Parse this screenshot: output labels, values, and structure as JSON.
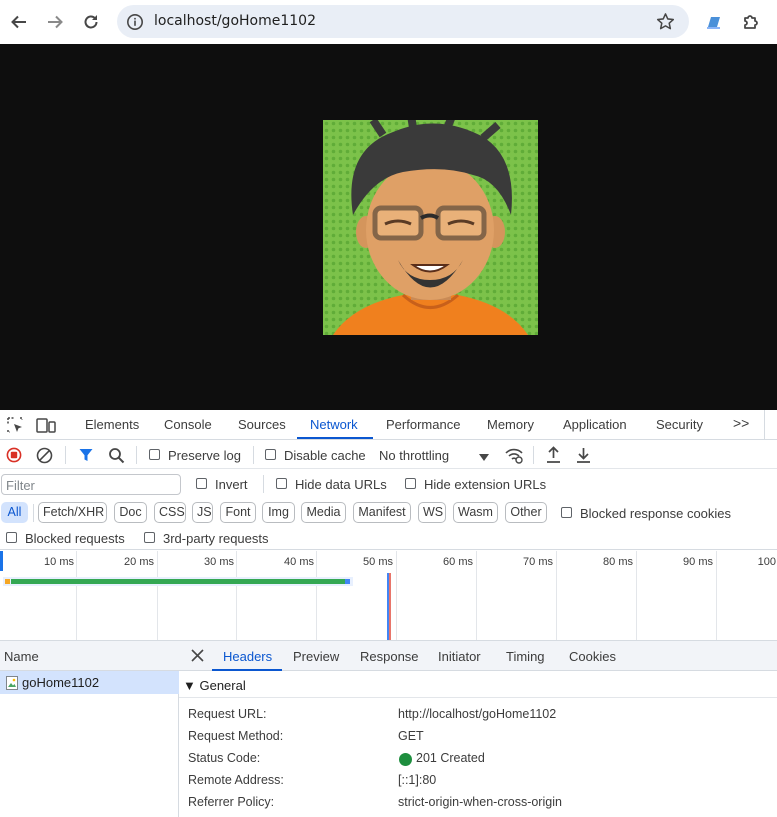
{
  "browser": {
    "url": "localhost/goHome1102",
    "icons": [
      "back-arrow-icon",
      "forward-arrow-icon",
      "reload-icon",
      "info-icon",
      "star-icon",
      "extension-icon",
      "puzzle-icon"
    ]
  },
  "devtools": {
    "tabs": [
      "Elements",
      "Console",
      "Sources",
      "Network",
      "Performance",
      "Memory",
      "Application",
      "Security"
    ],
    "active_tab": "Network",
    "more": ">>",
    "toolbar": {
      "preserve_log": "Preserve log",
      "disable_cache": "Disable cache",
      "throttling": "No throttling"
    },
    "filter": {
      "placeholder": "Filter",
      "invert": "Invert",
      "hide_data_urls": "Hide data URLs",
      "hide_extension_urls": "Hide extension URLs"
    },
    "types": [
      "All",
      "Fetch/XHR",
      "Doc",
      "CSS",
      "JS",
      "Font",
      "Img",
      "Media",
      "Manifest",
      "WS",
      "Wasm",
      "Other"
    ],
    "blocked_response_cookies": "Blocked response cookies",
    "blocked_requests": "Blocked requests",
    "third_party_requests": "3rd-party requests",
    "timeline_ticks": [
      "10 ms",
      "20 ms",
      "30 ms",
      "40 ms",
      "50 ms",
      "60 ms",
      "70 ms",
      "80 ms",
      "90 ms",
      "100"
    ],
    "list": {
      "header": "Name",
      "rows": [
        "goHome1102"
      ]
    },
    "details": {
      "tabs": [
        "Headers",
        "Preview",
        "Response",
        "Initiator",
        "Timing",
        "Cookies"
      ],
      "active_tab": "Headers",
      "section": "▼ General",
      "fields": [
        {
          "key": "Request URL:",
          "value": "http://localhost/goHome1102"
        },
        {
          "key": "Request Method:",
          "value": "GET"
        },
        {
          "key": "Status Code:",
          "value": "201 Created"
        },
        {
          "key": "Remote Address:",
          "value": "[::1]:80"
        },
        {
          "key": "Referrer Policy:",
          "value": "strict-origin-when-cross-origin"
        }
      ],
      "status_color": "#1e8e3e"
    }
  },
  "colors": {
    "accent": "#0b57d0",
    "record": "#d93025",
    "timeline_green": "#34a853",
    "timeline_blue": "#4285f4"
  }
}
